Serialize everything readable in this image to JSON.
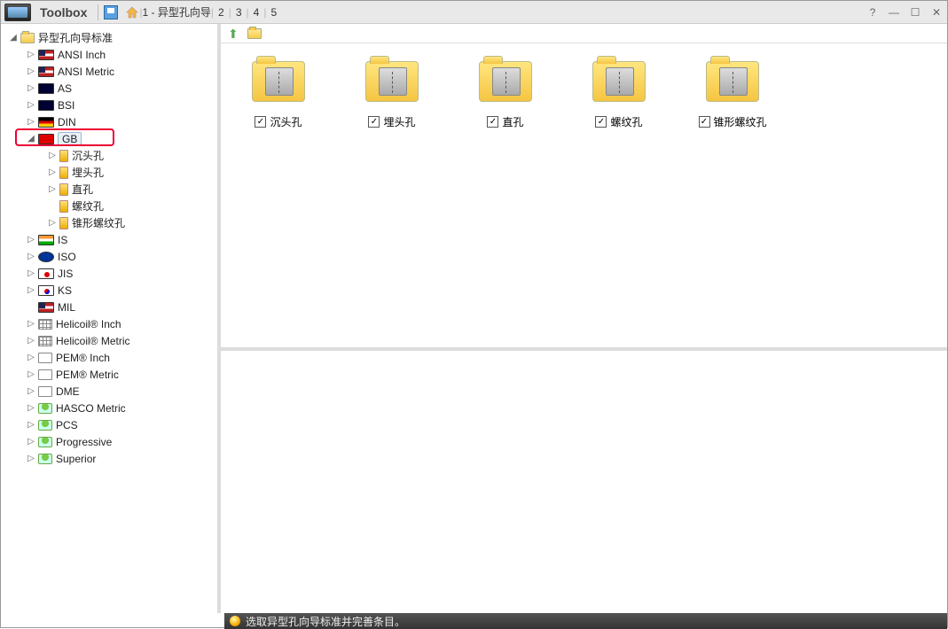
{
  "titlebar": {
    "title": "Toolbox",
    "path_current": "1 - 异型孔向导",
    "slots": [
      "2",
      "3",
      "4",
      "5"
    ]
  },
  "tree": {
    "root": {
      "label": "异型孔向导标准",
      "expanded": true,
      "iconcls": "folder"
    },
    "standards": [
      {
        "label": "ANSI Inch",
        "iconcls": "flag us",
        "twisty": true
      },
      {
        "label": "ANSI Metric",
        "iconcls": "flag us",
        "twisty": true
      },
      {
        "label": "AS",
        "iconcls": "flag au",
        "twisty": true
      },
      {
        "label": "BSI",
        "iconcls": "flag gb",
        "twisty": true
      },
      {
        "label": "DIN",
        "iconcls": "flag de",
        "twisty": true
      },
      {
        "label": "GB",
        "iconcls": "flag cn",
        "twisty": true,
        "expanded": true,
        "selected": true,
        "children": [
          {
            "label": "沉头孔",
            "iconcls": "hole",
            "twisty": true
          },
          {
            "label": "埋头孔",
            "iconcls": "hole",
            "twisty": true
          },
          {
            "label": "直孔",
            "iconcls": "hole",
            "twisty": true
          },
          {
            "label": "螺纹孔",
            "iconcls": "hole",
            "twisty": false
          },
          {
            "label": "锥形螺纹孔",
            "iconcls": "hole",
            "twisty": true
          }
        ]
      },
      {
        "label": "IS",
        "iconcls": "flag in",
        "twisty": true
      },
      {
        "label": "ISO",
        "iconcls": "flag eu",
        "twisty": true
      },
      {
        "label": "JIS",
        "iconcls": "flag jp",
        "twisty": true
      },
      {
        "label": "KS",
        "iconcls": "flag kr",
        "twisty": true
      },
      {
        "label": "MIL",
        "iconcls": "flag us",
        "twisty": false
      }
    ],
    "catalogs": [
      {
        "label": "Helicoil® Inch",
        "iconcls": "grid",
        "twisty": true
      },
      {
        "label": "Helicoil® Metric",
        "iconcls": "grid",
        "twisty": true
      },
      {
        "label": "PEM® Inch",
        "iconcls": "pem",
        "twisty": true
      },
      {
        "label": "PEM® Metric",
        "iconcls": "pem",
        "twisty": true
      },
      {
        "label": "DME",
        "iconcls": "dme",
        "twisty": true
      },
      {
        "label": "HASCO Metric",
        "iconcls": "person",
        "twisty": true
      },
      {
        "label": "PCS",
        "iconcls": "person",
        "twisty": true
      },
      {
        "label": "Progressive",
        "iconcls": "person",
        "twisty": true
      },
      {
        "label": "Superior",
        "iconcls": "person",
        "twisty": true
      }
    ]
  },
  "content": {
    "items": [
      {
        "label": "沉头孔",
        "checked": true
      },
      {
        "label": "埋头孔",
        "checked": true
      },
      {
        "label": "直孔",
        "checked": true
      },
      {
        "label": "螺纹孔",
        "checked": true
      },
      {
        "label": "锥形螺纹孔",
        "checked": true
      }
    ]
  },
  "statusbar": {
    "text": "选取异型孔向导标准并完善条目。"
  }
}
